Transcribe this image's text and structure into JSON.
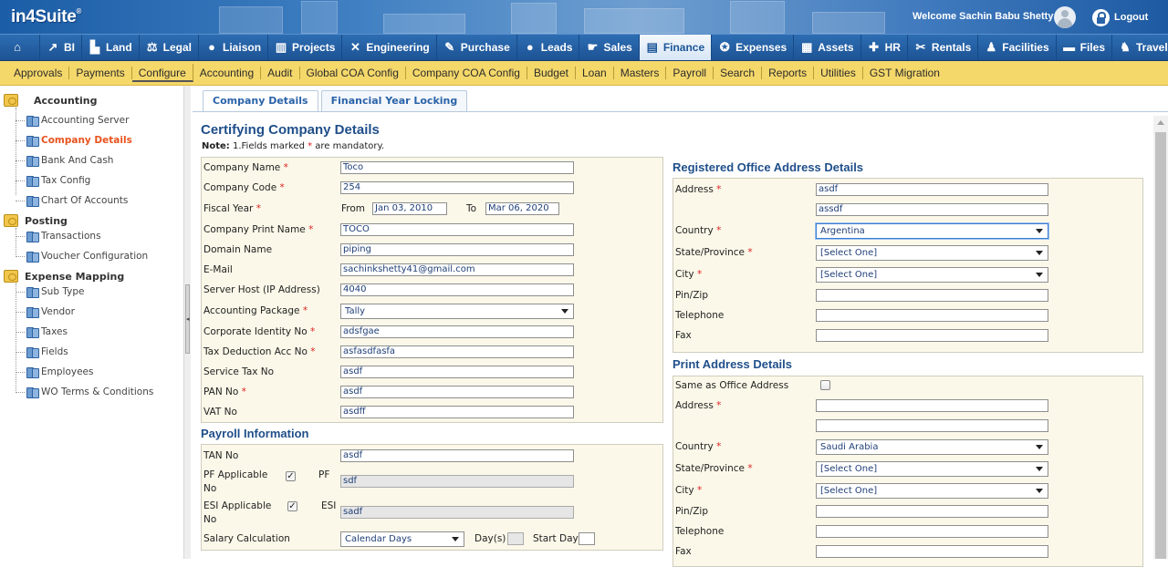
{
  "app": {
    "logo_text": "in4Suite",
    "logo_mark": "®",
    "welcome": "Welcome Sachin Babu Shetty",
    "logout": "Logout"
  },
  "modules": [
    {
      "label": "",
      "icon": "home-icon"
    },
    {
      "label": "BI",
      "icon": "chart-icon"
    },
    {
      "label": "Land",
      "icon": "land-icon"
    },
    {
      "label": "Legal",
      "icon": "scales-icon"
    },
    {
      "label": "Liaison",
      "icon": "person-icon"
    },
    {
      "label": "Projects",
      "icon": "building-icon"
    },
    {
      "label": "Engineering",
      "icon": "tools-icon"
    },
    {
      "label": "Purchase",
      "icon": "purchase-icon"
    },
    {
      "label": "Leads",
      "icon": "person-icon"
    },
    {
      "label": "Sales",
      "icon": "sales-icon"
    },
    {
      "label": "Finance",
      "icon": "finance-icon",
      "active": true
    },
    {
      "label": "Expenses",
      "icon": "expenses-icon"
    },
    {
      "label": "Assets",
      "icon": "assets-icon"
    },
    {
      "label": "HR",
      "icon": "hr-icon"
    },
    {
      "label": "Rentals",
      "icon": "rentals-icon"
    },
    {
      "label": "Facilities",
      "icon": "facilities-icon"
    },
    {
      "label": "Files",
      "icon": "folder-icon"
    },
    {
      "label": "Travel",
      "icon": "walk-icon"
    }
  ],
  "subnav": [
    "Approvals",
    "Payments",
    "Configure",
    "Accounting",
    "Audit",
    "Global COA Config",
    "Company COA Config",
    "Budget",
    "Loan",
    "Masters",
    "Payroll",
    "Search",
    "Reports",
    "Utilities",
    "GST Migration"
  ],
  "subnav_active": "Configure",
  "sidebar": {
    "groups": [
      {
        "label": "Accounting",
        "items": [
          "Accounting Server",
          "Company Details",
          "Bank And Cash",
          "Tax Config",
          "Chart Of Accounts"
        ]
      },
      {
        "label": "Posting",
        "items": [
          "Transactions",
          "Voucher Configuration"
        ]
      },
      {
        "label": "Expense Mapping",
        "items": [
          "Sub Type",
          "Vendor",
          "Taxes",
          "Fields",
          "Employees",
          "WO Terms & Conditions"
        ]
      }
    ],
    "active_item": "Company Details"
  },
  "tabs": [
    {
      "label": "Company Details",
      "active": true
    },
    {
      "label": "Financial Year Locking",
      "active": false
    }
  ],
  "page_title": "Certifying Company Details",
  "note": {
    "prefix": "Note:",
    "text1": " 1.Fields marked ",
    "star": "*",
    "text2": " are mandatory."
  },
  "company": {
    "name_label": "Company Name",
    "name": "Toco",
    "code_label": "Company Code",
    "code": "254",
    "fy_label": "Fiscal Year",
    "fy_from_label": "From",
    "fy_from": "Jan 03, 2010",
    "fy_to_label": "To",
    "fy_to": "Mar 06, 2020",
    "print_name_label": "Company Print Name",
    "print_name": "TOCO",
    "domain_label": "Domain Name",
    "domain": "piping",
    "email_label": "E-Mail",
    "email": "sachinkshetty41@gmail.com",
    "server_label": "Server Host (IP Address)",
    "server": "4040",
    "package_label": "Accounting Package",
    "package": "Tally",
    "cin_label": "Corporate Identity No",
    "cin": "adsfgae",
    "tan_ded_label": "Tax Deduction Acc No",
    "tan_ded": "asfasdfasfa",
    "stax_label": "Service Tax No",
    "stax": "asdf",
    "pan_label": "PAN No",
    "pan": "asdf",
    "vat_label": "VAT No",
    "vat": "asdff"
  },
  "payroll": {
    "title": "Payroll Information",
    "tan_label": "TAN No",
    "tan": "asdf",
    "pf_label": "PF Applicable",
    "pf_label2": "PF",
    "pf_label3": "No",
    "pf_checked": "✓",
    "pf_value": "sdf",
    "esi_label": "ESI Applicable",
    "esi_label2": "ESI",
    "esi_label3": "No",
    "esi_checked": "✓",
    "esi_value": "sadf",
    "salary_label": "Salary Calculation",
    "salary": "Calendar Days",
    "days_label": "Day(s)",
    "start_day_label": "Start Day"
  },
  "registered": {
    "title": "Registered Office Address Details",
    "address_label": "Address",
    "address1": "asdf",
    "address2": "assdf",
    "country_label": "Country",
    "country": "Argentina",
    "state_label": "State/Province",
    "state": "[Select One]",
    "city_label": "City",
    "city": "[Select One]",
    "pin_label": "Pin/Zip",
    "tel_label": "Telephone",
    "fax_label": "Fax"
  },
  "print_addr": {
    "title": "Print Address Details",
    "same_label": "Same as Office Address",
    "address_label": "Address",
    "country_label": "Country",
    "country": "Saudi Arabia",
    "state_label": "State/Province",
    "state": "[Select One]",
    "city_label": "City",
    "city": "[Select One]",
    "pin_label": "Pin/Zip",
    "tel_label": "Telephone",
    "fax_label": "Fax"
  },
  "colors": {
    "accent": "#1f4f8a",
    "subnav": "#f5d86a",
    "active_link": "#e8531e",
    "required": "#dd2222"
  }
}
